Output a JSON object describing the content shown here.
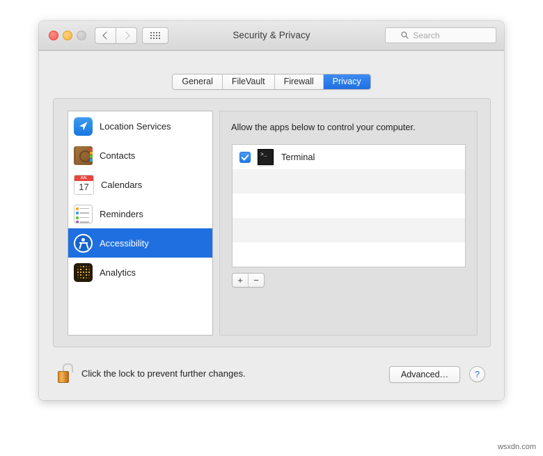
{
  "window": {
    "title": "Security & Privacy",
    "traffic_lights": [
      "close",
      "minimize",
      "zoom"
    ],
    "nav_back_label": "Back",
    "nav_forward_label": "Forward",
    "grid_button_label": "Show All",
    "colors": {
      "accent": "#1f6fe0",
      "titlebar": "#e0e0e0",
      "window_bg": "#ececec",
      "help_blue": "#2a6fd6",
      "lock_orange": "#d4882a"
    }
  },
  "search": {
    "placeholder": "Search",
    "value": "",
    "icon": "search-icon"
  },
  "tabs": [
    {
      "label": "General",
      "active": false
    },
    {
      "label": "FileVault",
      "active": false
    },
    {
      "label": "Firewall",
      "active": false
    },
    {
      "label": "Privacy",
      "active": true
    }
  ],
  "sidebar": {
    "items": [
      {
        "label": "Location Services",
        "icon": "location-services-icon",
        "selected": false
      },
      {
        "label": "Contacts",
        "icon": "contacts-icon",
        "selected": false
      },
      {
        "label": "Calendars",
        "icon": "calendars-icon",
        "selected": false
      },
      {
        "label": "Reminders",
        "icon": "reminders-icon",
        "selected": false
      },
      {
        "label": "Accessibility",
        "icon": "accessibility-icon",
        "selected": true
      },
      {
        "label": "Analytics",
        "icon": "analytics-icon",
        "selected": false
      }
    ],
    "calendar_icon": {
      "month": "JUL",
      "day": "17"
    }
  },
  "detail": {
    "description": "Allow the apps below to control your computer.",
    "apps": [
      {
        "name": "Terminal",
        "checked": true,
        "icon": "terminal-icon",
        "icon_glyph": ">_"
      }
    ],
    "empty_row_count": 4,
    "add_button_label": "+",
    "remove_button_label": "−"
  },
  "bottom": {
    "lock_icon": "lock-open-icon",
    "lock_text": "Click the lock to prevent further changes.",
    "advanced_label": "Advanced…",
    "help_label": "?"
  },
  "watermark": "wsxdn.com"
}
